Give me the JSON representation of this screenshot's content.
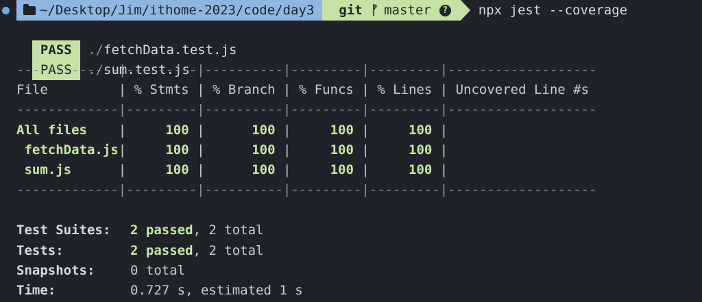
{
  "prompt": {
    "directory": "~/Desktop/Jim/ithome-2023/code/day3",
    "git_label": "git",
    "branch_symbol": "ᚠ",
    "branch": "master",
    "status_symbol": "?",
    "command": "npx jest --coverage"
  },
  "test_files": [
    {
      "status": "PASS",
      "dir": "./",
      "file": "fetchData.test.js"
    },
    {
      "status": "PASS",
      "dir": "./",
      "file": "sum.test.js"
    }
  ],
  "coverage_table": {
    "rule_top": "-------------|---------|----------|---------|---------|-------------------",
    "header": "File         | % Stmts | % Branch | % Funcs | % Lines | Uncovered Line #s ",
    "rule_mid": "-------------|---------|----------|---------|---------|-------------------",
    "rows": [
      {
        "file": "All files   ",
        "stmts": "100",
        "branch": "100",
        "funcs": "100",
        "lines": "100",
        "uncovered": ""
      },
      {
        "file": " fetchData.js",
        "stmts": "100",
        "branch": "100",
        "funcs": "100",
        "lines": "100",
        "uncovered": ""
      },
      {
        "file": " sum.js      ",
        "stmts": "100",
        "branch": "100",
        "funcs": "100",
        "lines": "100",
        "uncovered": ""
      }
    ],
    "rule_bottom": "-------------|---------|----------|---------|---------|-------------------"
  },
  "summary": {
    "suites": {
      "label": "Test Suites:",
      "passed": "2 passed",
      "rest": ", 2 total"
    },
    "tests": {
      "label": "Tests:",
      "passed": "2 passed",
      "rest": ", 2 total"
    },
    "snapshots": {
      "label": "Snapshots:",
      "value": "0 total"
    },
    "time": {
      "label": "Time:",
      "value": "0.727 s, estimated 1 s"
    }
  },
  "colors": {
    "background": "#1f2329",
    "dir_segment": "#8fb6e0",
    "git_segment": "#c5e2a4",
    "pass_badge": "#c5e2a4",
    "coverage_green": "#c5e8a0"
  }
}
